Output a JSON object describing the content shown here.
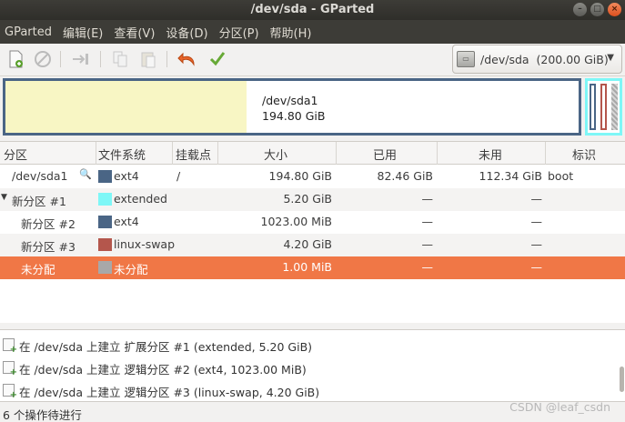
{
  "window": {
    "title": "/dev/sda - GParted"
  },
  "menu": [
    "GParted",
    "编辑(E)",
    "查看(V)",
    "设备(D)",
    "分区(P)",
    "帮助(H)"
  ],
  "toolbar": {
    "buttons": [
      "new-icon",
      "delete-icon",
      "resize-move-icon",
      "copy-icon",
      "paste-icon",
      "undo-icon",
      "apply-icon"
    ],
    "device_selector": "/dev/sda  (200.00 GiB)"
  },
  "diskmap": {
    "part1_name": "/dev/sda1",
    "part1_size": "194.80 GiB",
    "colors": {
      "ext4": "#4a6585",
      "extended": "#7ef7f7",
      "swap": "#b4564c",
      "used_fill": "#f8f6c4"
    }
  },
  "table": {
    "headers": [
      "分区",
      "文件系统",
      "挂载点",
      "大小",
      "已用",
      "未用",
      "标识"
    ],
    "rows": [
      {
        "partition": "/dev/sda1",
        "fs": "ext4",
        "mount": "/",
        "size": "194.80 GiB",
        "used": "82.46 GiB",
        "unused": "112.34 GiB",
        "flags": "boot",
        "color": "#4a6585"
      },
      {
        "partition": "新分区 #1",
        "fs": "extended",
        "mount": "",
        "size": "5.20 GiB",
        "used": "—",
        "unused": "—",
        "flags": "",
        "color": "#7ef7f7"
      },
      {
        "partition": "新分区 #2",
        "fs": "ext4",
        "mount": "",
        "size": "1023.00 MiB",
        "used": "—",
        "unused": "—",
        "flags": "",
        "color": "#4a6585"
      },
      {
        "partition": "新分区 #3",
        "fs": "linux-swap",
        "mount": "",
        "size": "4.20 GiB",
        "used": "—",
        "unused": "—",
        "flags": "",
        "color": "#b4564c"
      },
      {
        "partition": "未分配",
        "fs": "未分配",
        "mount": "",
        "size": "1.00 MiB",
        "used": "—",
        "unused": "—",
        "flags": "",
        "color": "#a8a8a8"
      }
    ]
  },
  "operations": [
    "在 /dev/sda 上建立 扩展分区 #1 (extended, 5.20 GiB)",
    "在 /dev/sda 上建立 逻辑分区 #2 (ext4, 1023.00 MiB)",
    "在 /dev/sda 上建立 逻辑分区 #3 (linux-swap, 4.20 GiB)"
  ],
  "status": "6 个操作待进行",
  "watermark": "CSDN @leaf_csdn"
}
